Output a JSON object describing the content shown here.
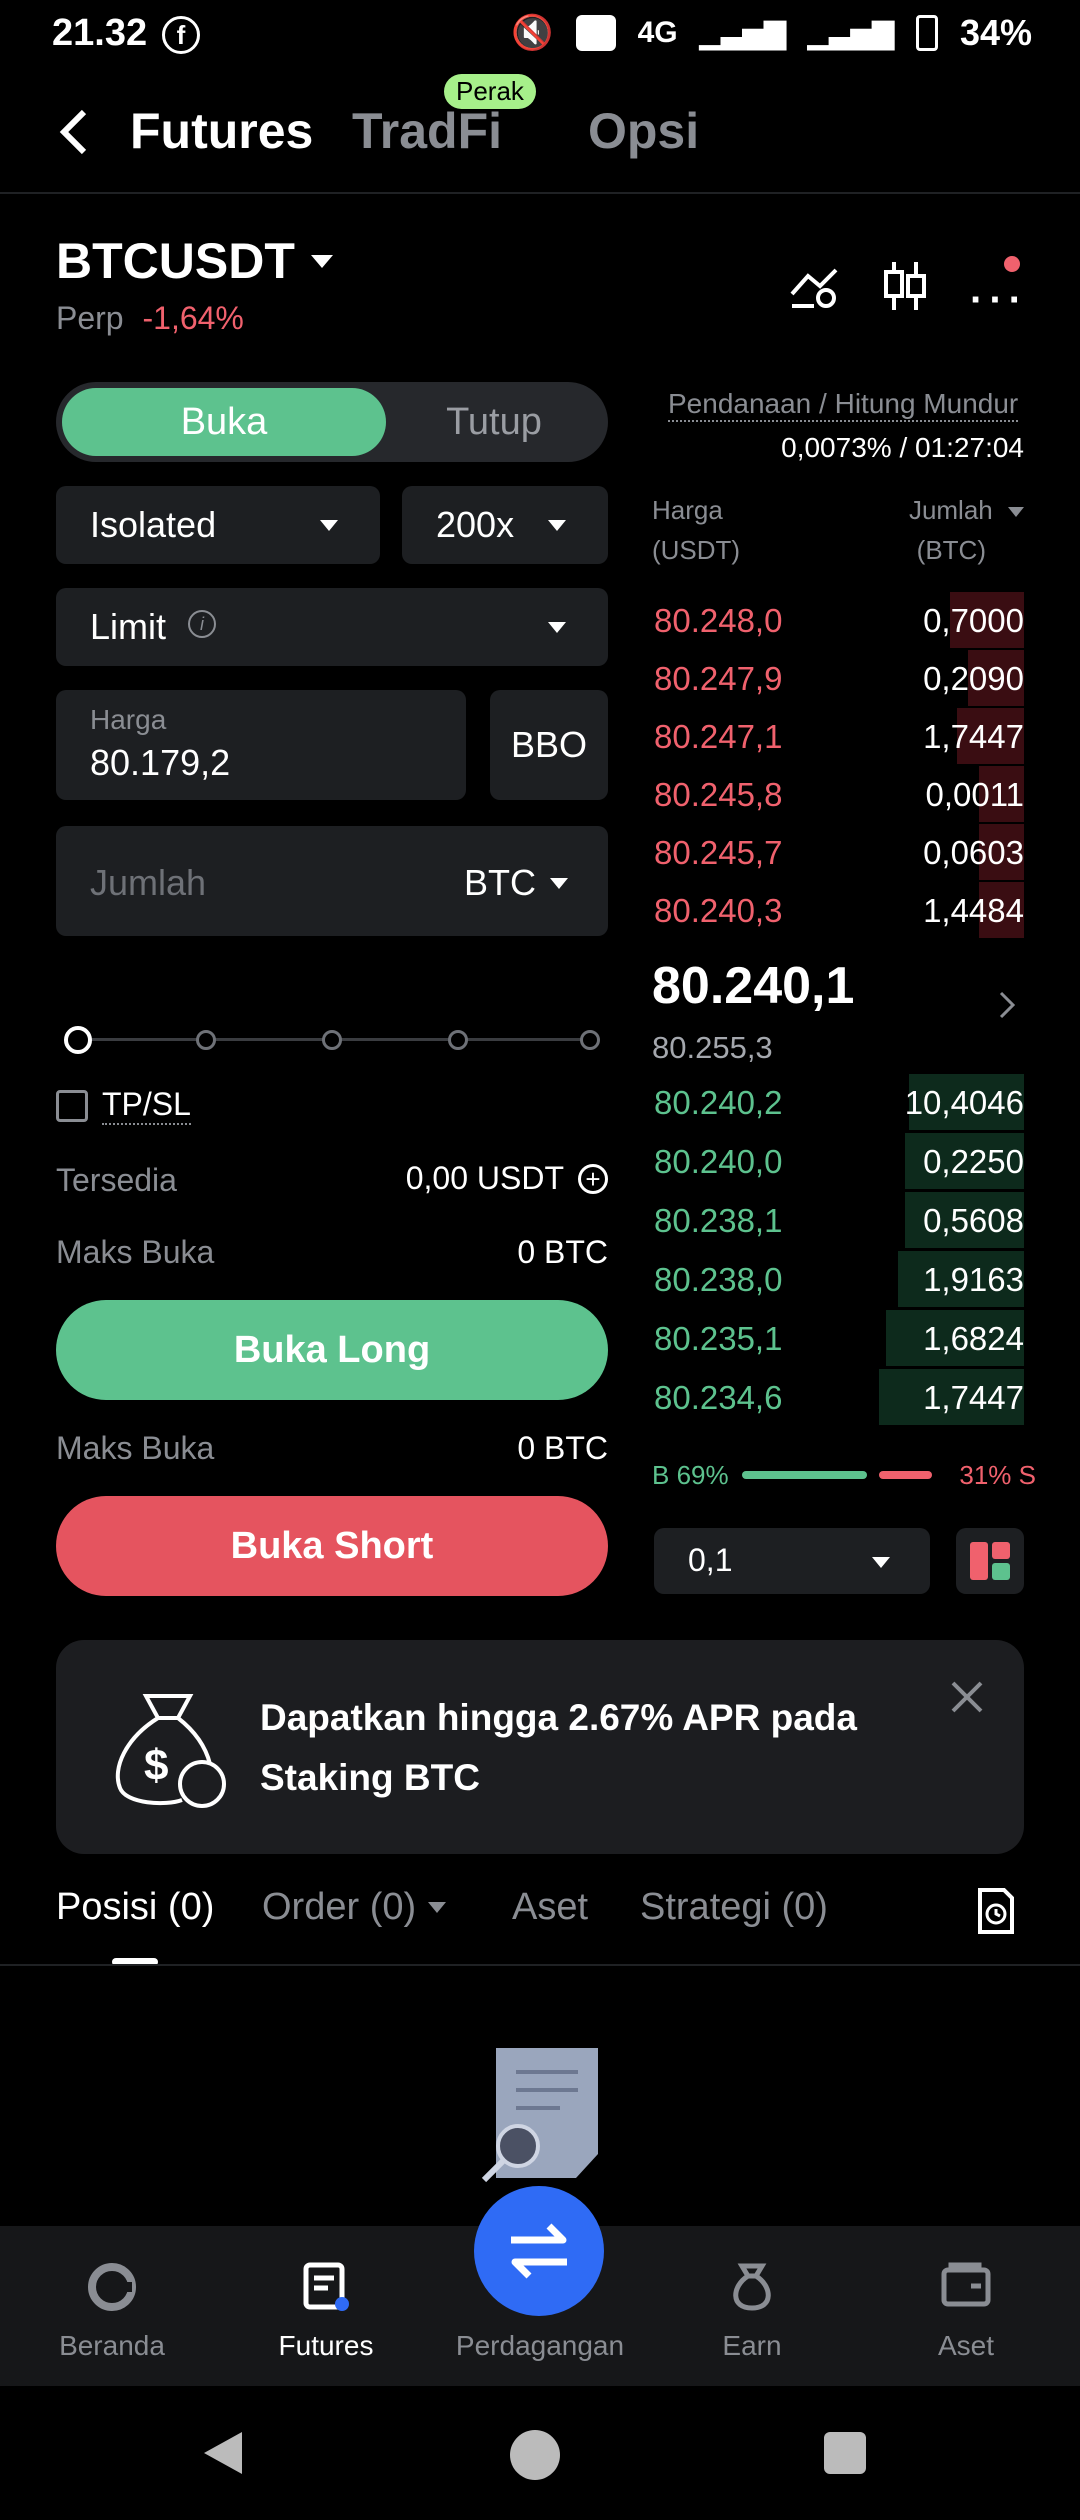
{
  "status": {
    "time": "21.32",
    "network": "4G",
    "battery": "34%"
  },
  "nav": {
    "tabs": [
      "Futures",
      "TradFi",
      "Opsi"
    ],
    "badge": "Perak"
  },
  "symbol": {
    "name": "BTCUSDT",
    "type": "Perp",
    "change": "-1,64%"
  },
  "form": {
    "open_label": "Buka",
    "close_label": "Tutup",
    "margin_mode": "Isolated",
    "leverage": "200x",
    "order_type": "Limit",
    "price_label": "Harga",
    "price_value": "80.179,2",
    "bbo": "BBO",
    "amount_placeholder": "Jumlah",
    "amount_unit": "BTC",
    "tpsl": "TP/SL",
    "available_label": "Tersedia",
    "available_value": "0,00 USDT",
    "max_open_label": "Maks Buka",
    "max_long": "0 BTC",
    "max_short": "0 BTC",
    "long_button": "Buka Long",
    "short_button": "Buka Short"
  },
  "orderbook": {
    "funding_label": "Pendanaan / Hitung Mundur",
    "funding_value": "0,0073% / 01:27:04",
    "col_price": "Harga",
    "col_price_unit": "(USDT)",
    "col_qty": "Jumlah",
    "col_qty_unit": "(BTC)",
    "asks": [
      {
        "price": "80.248,0",
        "qty": "0,7000",
        "depth": 0.2
      },
      {
        "price": "80.247,9",
        "qty": "0,2090",
        "depth": 0.15
      },
      {
        "price": "80.247,1",
        "qty": "1,7447",
        "depth": 0.18
      },
      {
        "price": "80.245,8",
        "qty": "0,0011",
        "depth": 0.12
      },
      {
        "price": "80.245,7",
        "qty": "0,0603",
        "depth": 0.12
      },
      {
        "price": "80.240,3",
        "qty": "1,4484",
        "depth": 0.12
      }
    ],
    "last_price": "80.240,1",
    "mark_price": "80.255,3",
    "bids": [
      {
        "price": "80.240,2",
        "qty": "10,4046",
        "depth": 0.31
      },
      {
        "price": "80.240,0",
        "qty": "0,2250",
        "depth": 0.32
      },
      {
        "price": "80.238,1",
        "qty": "0,5608",
        "depth": 0.32
      },
      {
        "price": "80.238,0",
        "qty": "1,9163",
        "depth": 0.34
      },
      {
        "price": "80.235,1",
        "qty": "1,6824",
        "depth": 0.37
      },
      {
        "price": "80.234,6",
        "qty": "1,7447",
        "depth": 0.39
      }
    ],
    "buy_pct_label": "B 69%",
    "sell_pct_label": "31% S",
    "buy_ratio": 0.69,
    "precision": "0,1"
  },
  "banner": {
    "text": "Dapatkan hingga 2.67% APR pada Staking BTC"
  },
  "tabs": {
    "positions": "Posisi (0)",
    "orders": "Order (0)",
    "assets": "Aset",
    "strategies": "Strategi (0)"
  },
  "bottom_nav": {
    "home": "Beranda",
    "futures": "Futures",
    "trade": "Perdagangan",
    "earn": "Earn",
    "assets": "Aset"
  },
  "colors": {
    "green": "#5dc28e",
    "red": "#f0616d",
    "blue": "#2f6bf5"
  }
}
